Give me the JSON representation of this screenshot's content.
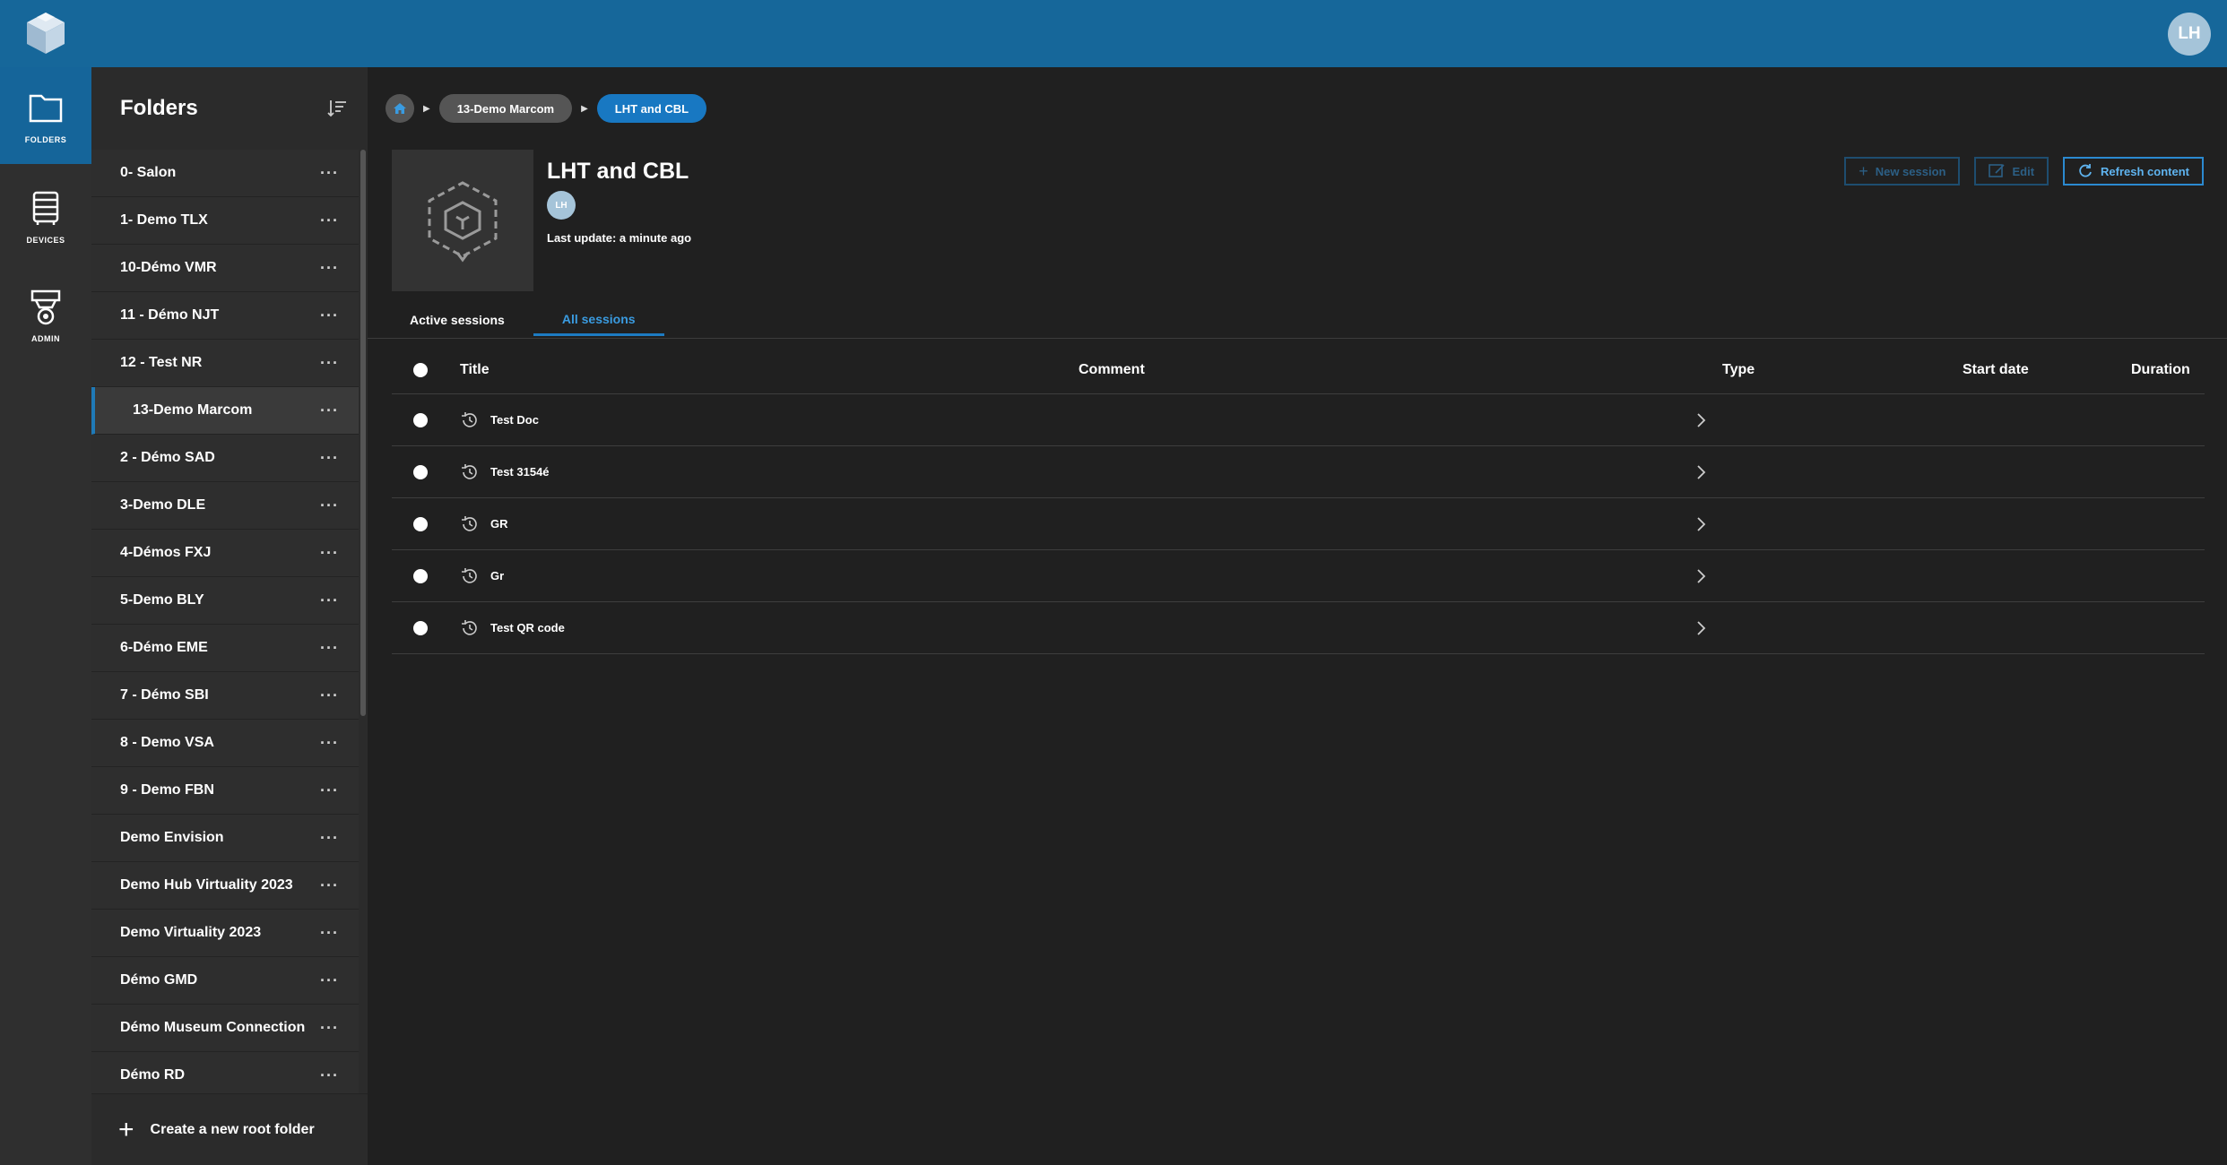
{
  "header": {
    "user_initials": "LH"
  },
  "rail": [
    {
      "label": "FOLDERS",
      "icon": "folder-icon"
    },
    {
      "label": "DEVICES",
      "icon": "devices-icon"
    },
    {
      "label": "ADMIN",
      "icon": "admin-icon"
    }
  ],
  "folders": {
    "title": "Folders",
    "items": [
      "0- Salon",
      "1- Demo TLX",
      "10-Démo VMR",
      "11 - Démo NJT",
      "12 - Test NR",
      "13-Demo Marcom",
      "2 - Démo SAD",
      "3-Demo DLE",
      "4-Démos FXJ",
      "5-Demo BLY",
      "6-Démo EME",
      "7 - Démo SBI",
      "8 - Demo VSA",
      "9 - Demo FBN",
      "Demo Envision",
      "Demo Hub Virtuality 2023",
      "Demo Virtuality 2023",
      "Démo GMD",
      "Démo Museum Connection",
      "Démo RD"
    ],
    "selected_index": 5,
    "menu_label": "···",
    "create_label": "Create a new root folder"
  },
  "breadcrumb": {
    "parent": "13-Demo Marcom",
    "current": "LHT and CBL"
  },
  "content": {
    "name": "LHT and CBL",
    "owner_initials": "LH",
    "last_update": "Last update: a minute ago"
  },
  "actions": {
    "new_session": "New session",
    "edit": "Edit",
    "refresh": "Refresh content"
  },
  "tabs": {
    "active_sessions": "Active sessions",
    "all_sessions": "All sessions"
  },
  "table": {
    "columns": {
      "title": "Title",
      "comment": "Comment",
      "type": "Type",
      "start_date": "Start date",
      "duration": "Duration"
    },
    "rows": [
      "Test Doc",
      "Test 3154é",
      "GR",
      "Gr",
      "Test QR code"
    ]
  },
  "colors": {
    "topbar": "#16679a",
    "accent": "#1878c2",
    "background": "#202020"
  }
}
